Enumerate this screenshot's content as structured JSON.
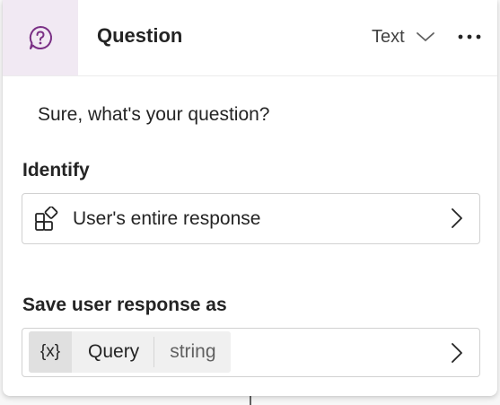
{
  "header": {
    "title": "Question",
    "icon": "question-circle-icon",
    "type_dropdown": {
      "selected": "Text"
    },
    "more_icon": "more-horizontal-icon"
  },
  "message": "Sure, what's your question?",
  "identify": {
    "label": "Identify",
    "value": "User's entire response",
    "icon": "apps-add-icon"
  },
  "save": {
    "label": "Save user response as",
    "variable_icon_text": "{x}",
    "variable_name": "Query",
    "variable_type": "string"
  },
  "colors": {
    "accent_purple": "#7a2f85",
    "icon_bg": "#f1e9f3",
    "text": "#242424",
    "border": "#d1d1d1"
  }
}
